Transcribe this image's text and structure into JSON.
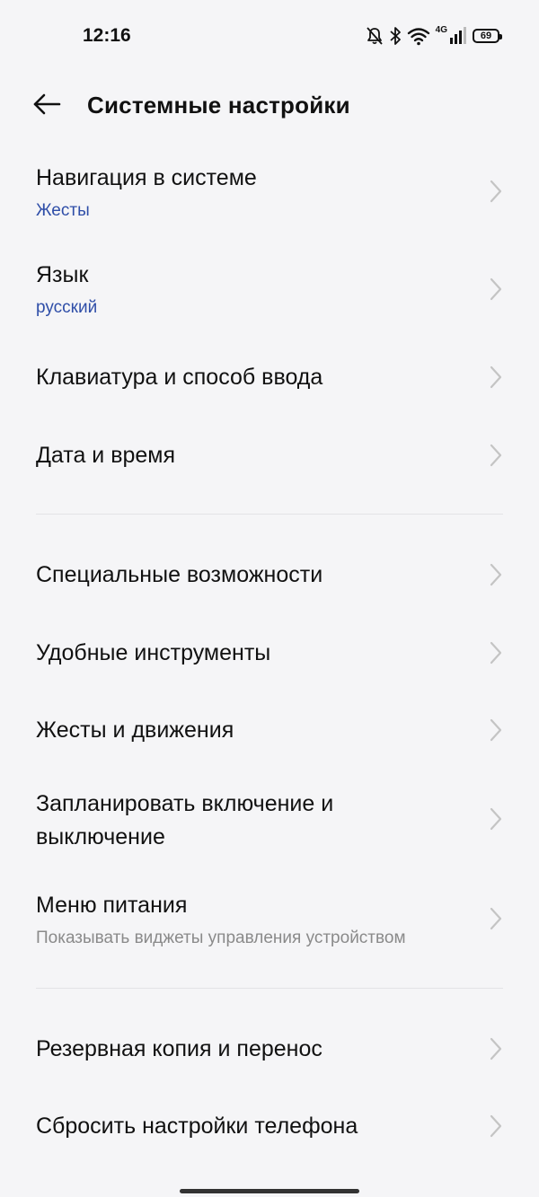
{
  "status_bar": {
    "time": "12:16",
    "network_type": "4G",
    "battery_level": "69",
    "icons": [
      "bell-off-icon",
      "bluetooth-icon",
      "wifi-icon",
      "signal-icon",
      "battery-icon"
    ]
  },
  "header": {
    "back_icon": "arrow-left-icon",
    "title": "Системные настройки"
  },
  "items": [
    {
      "title": "Навигация в системе",
      "subtitle": "Жесты"
    },
    {
      "title": "Язык",
      "subtitle": "русский"
    },
    {
      "title": "Клавиатура и способ ввода"
    },
    {
      "title": "Дата и время"
    },
    {
      "title": "Специальные возможности"
    },
    {
      "title": "Удобные инструменты"
    },
    {
      "title": "Жесты и движения"
    },
    {
      "title": "Запланировать включение и выключение",
      "title_line1": "Запланировать включение и",
      "title_line2": "выключение"
    },
    {
      "title": "Меню питания",
      "subtitle": "Показывать виджеты управления устройством"
    },
    {
      "title": "Резервная копия и перенос"
    },
    {
      "title": "Сбросить настройки телефона"
    }
  ],
  "colors": {
    "background": "#f5f5f7",
    "accent": "#2f4ea8",
    "muted_text": "#8a8a8a",
    "chevron": "#c4c4c4",
    "divider": "#e3e3e6"
  }
}
